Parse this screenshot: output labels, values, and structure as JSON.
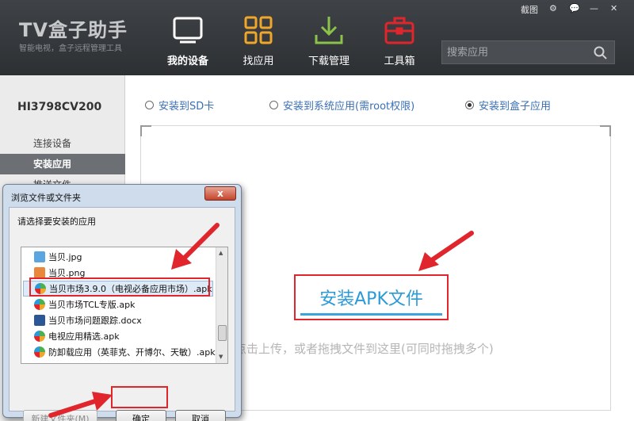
{
  "header": {
    "logo_title": "TV盒子助手",
    "logo_subtitle": "智能电视，盒子远程管理工具",
    "nav": [
      {
        "label": "我的设备",
        "icon": "tv-icon",
        "active": true
      },
      {
        "label": "找应用",
        "icon": "grid-icon",
        "active": false
      },
      {
        "label": "下载管理",
        "icon": "download-icon",
        "active": false
      },
      {
        "label": "工具箱",
        "icon": "toolbox-icon",
        "active": false
      }
    ],
    "screenshot_label": "截图",
    "search_placeholder": "搜索应用"
  },
  "sidebar": {
    "device_name": "HI3798CV200",
    "items": [
      {
        "label": "连接设备",
        "active": false
      },
      {
        "label": "安装应用",
        "active": true
      },
      {
        "label": "推送文件",
        "active": false
      }
    ]
  },
  "install_options": [
    {
      "label": "安装到SD卡",
      "checked": false
    },
    {
      "label": "安装到系统应用(需root权限)",
      "checked": false
    },
    {
      "label": "安装到盒子应用",
      "checked": true
    }
  ],
  "drop_area": {
    "button_label": "安装APK文件",
    "hint": "点击上传，或者拖拽文件到这里(可同时拖拽多个)"
  },
  "dialog": {
    "title": "浏览文件或文件夹",
    "close_label": "x",
    "prompt": "请选择要安装的应用",
    "files": [
      {
        "name": "当贝.jpg",
        "type": "jpg",
        "selected": false
      },
      {
        "name": "当贝.png",
        "type": "png",
        "selected": false
      },
      {
        "name": "当贝市场3.9.0（电视必备应用市场）.apk",
        "type": "apk",
        "selected": true
      },
      {
        "name": "当贝市场TCL专版.apk",
        "type": "apk",
        "selected": false
      },
      {
        "name": "当贝市场问题跟踪.docx",
        "type": "docx",
        "selected": false
      },
      {
        "name": "电视应用精选.apk",
        "type": "apk",
        "selected": false
      },
      {
        "name": "防卸载应用（英菲克、开博尔、天敏）.apk",
        "type": "apk",
        "selected": false
      }
    ],
    "new_folder_label": "新建文件夹(M)",
    "ok_label": "确定",
    "cancel_label": "取消"
  },
  "colors": {
    "header_bg": "#34383b",
    "accent_orange": "#f0a62a",
    "accent_green": "#8bc34a",
    "accent_red": "#e0262c",
    "link_blue": "#3a6fb5",
    "install_blue": "#2d9ad8"
  }
}
